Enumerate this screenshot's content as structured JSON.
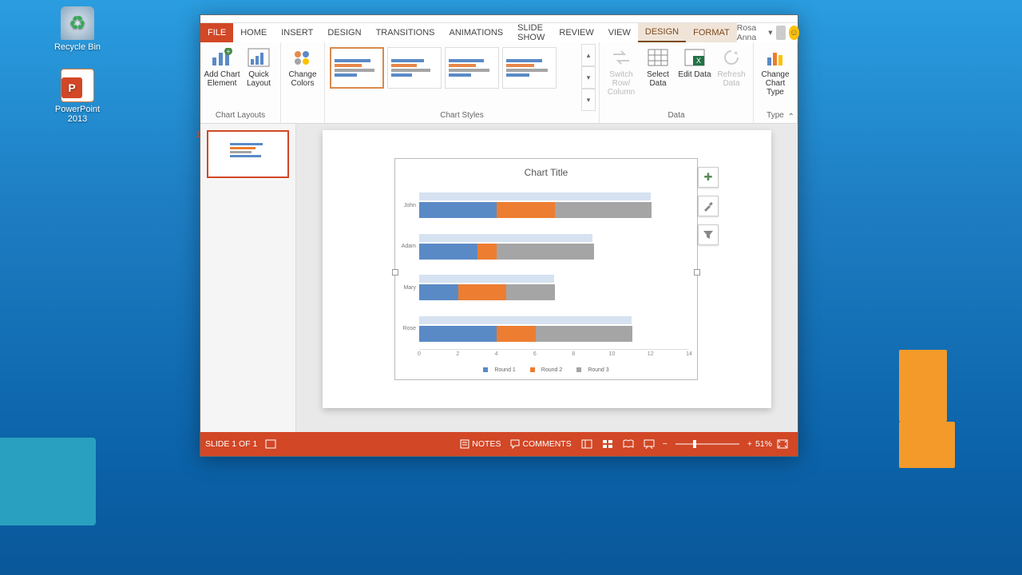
{
  "desktop": {
    "recycle_bin": "Recycle Bin",
    "powerpoint_icon": "PowerPoint 2013"
  },
  "ribbon": {
    "tabs": {
      "file": "FILE",
      "home": "HOME",
      "insert": "INSERT",
      "design": "DESIGN",
      "transitions": "TRANSITIONS",
      "animations": "ANIMATIONS",
      "slide_show": "SLIDE SHOW",
      "review": "REVIEW",
      "view": "VIEW",
      "ct_design": "DESIGN",
      "ct_format": "FORMAT"
    },
    "user": "Rosa Anna",
    "groups": {
      "chart_layouts": "Chart Layouts",
      "chart_styles": "Chart Styles",
      "data": "Data",
      "type": "Type"
    },
    "buttons": {
      "add_element": "Add Chart Element",
      "quick_layout": "Quick Layout",
      "change_colors": "Change Colors",
      "switch_row": "Switch Row/ Column",
      "select_data": "Select Data",
      "edit_data": "Edit Data",
      "refresh_data": "Refresh Data",
      "change_type": "Change Chart Type"
    }
  },
  "slide": {
    "number": "1",
    "chart_title": "Chart Title"
  },
  "chart_data": {
    "type": "bar",
    "title": "Chart Title",
    "categories": [
      "John",
      "Adam",
      "Mary",
      "Rose"
    ],
    "series": [
      {
        "name": "Round 1",
        "values": [
          4.0,
          3.0,
          2.0,
          4.0
        ]
      },
      {
        "name": "Round 2",
        "values": [
          3.0,
          1.0,
          2.5,
          2.0
        ]
      },
      {
        "name": "Round 3",
        "values": [
          5.0,
          5.0,
          2.5,
          5.0
        ]
      }
    ],
    "xlabel": "",
    "ylabel": "",
    "xlim": [
      0,
      14
    ],
    "xticks": [
      0,
      2,
      4,
      6,
      8,
      10,
      12,
      14
    ],
    "legend": [
      "Round 1",
      "Round 2",
      "Round 3"
    ]
  },
  "status": {
    "slide_info": "SLIDE 1 OF 1",
    "notes": "NOTES",
    "comments": "COMMENTS",
    "zoom": "51%"
  }
}
